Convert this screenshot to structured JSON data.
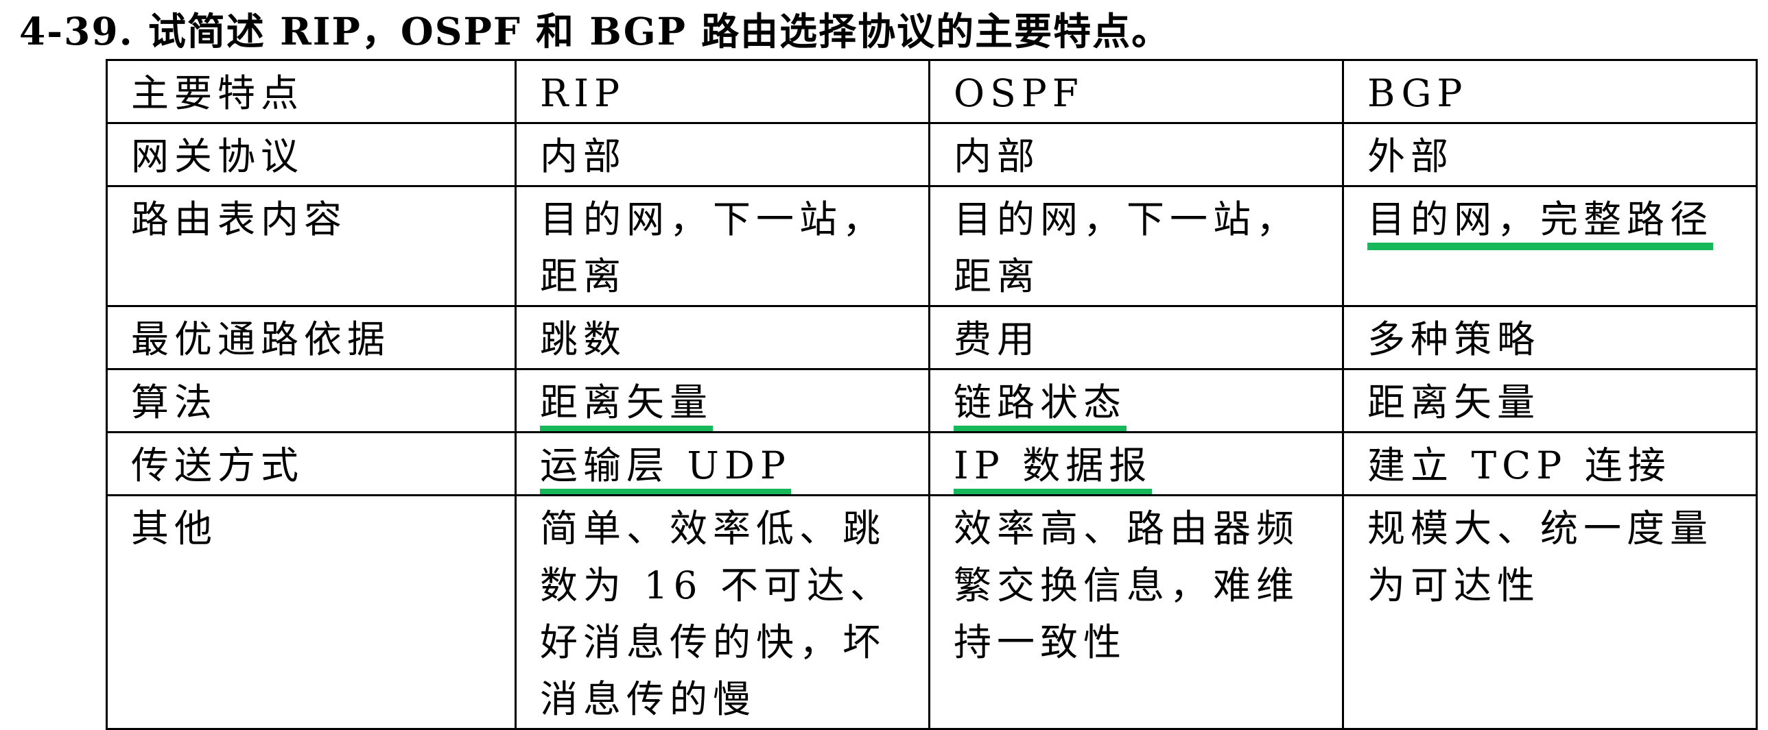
{
  "question": {
    "title": "4-39. 试简述 RIP，OSPF 和 BGP 路由选择协议的主要特点。"
  },
  "table": {
    "headers": [
      "主要特点",
      "RIP",
      "OSPF",
      "BGP"
    ],
    "rows": [
      {
        "feature": "网关协议",
        "rip": "内部",
        "ospf": "内部",
        "bgp": "外部"
      },
      {
        "feature": "路由表内容",
        "rip": "目的网，下一站，距离",
        "ospf": "目的网，下一站，距离",
        "bgp": "目的网，完整路径"
      },
      {
        "feature": "最优通路依据",
        "rip": "跳数",
        "ospf": "费用",
        "bgp": "多种策略"
      },
      {
        "feature": "算法",
        "rip": "距离矢量",
        "ospf": "链路状态",
        "bgp": "距离矢量"
      },
      {
        "feature": "传送方式",
        "rip": "运输层 UDP",
        "ospf": "IP 数据报",
        "bgp": "建立 TCP 连接"
      },
      {
        "feature": "其他",
        "rip": "简单、效率低、跳数为 16 不可达、好消息传的快，坏消息传的慢",
        "ospf": "效率高、路由器频繁交换信息，难维持一致性",
        "bgp": "规模大、统一度量为可达性"
      }
    ]
  },
  "highlight_color": "#16b85a"
}
